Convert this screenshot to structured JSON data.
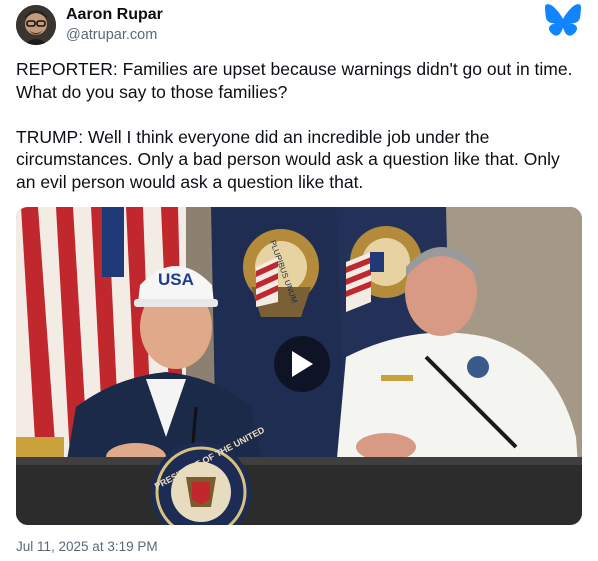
{
  "post": {
    "author": {
      "display_name": "Aaron Rupar",
      "handle": "@atrupar.com",
      "avatar_icon": "avatar-photo"
    },
    "platform_logo_icon": "bluesky-butterfly-icon",
    "brand_color": "#1185fe",
    "text_lines": [
      "REPORTER: Families are upset because warnings didn't go out in time.",
      "What do you say to those families?",
      "",
      "TRUMP: Well I think everyone did an incredible job under the",
      "circumstances. Only a bad person would ask a question like that. Only",
      "an evil person would ask a question like that."
    ],
    "video": {
      "play_icon": "play-icon",
      "hat_text": "USA",
      "seal_text": "PRESIDENT OF THE UNITED",
      "flag_text": "PLURIBUS UNUM"
    },
    "timestamp": "Jul 11, 2025 at 3:19 PM"
  }
}
